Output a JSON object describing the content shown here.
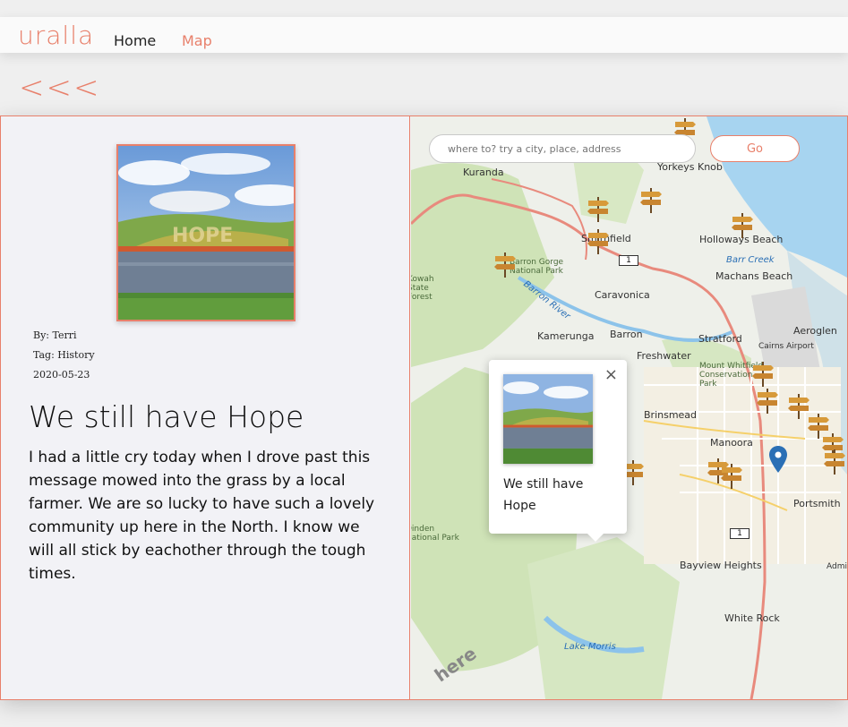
{
  "nav": {
    "logo": "uralla",
    "home": "Home",
    "map": "Map"
  },
  "back_label": "<<<",
  "story": {
    "author": "By: Terri",
    "tag": "Tag: History",
    "date": "2020-05-23",
    "title": "We still have Hope",
    "body": "I had a little cry today when I drove past this message mowed into the grass by a local farmer. We are so lucky to have such a lovely community up here in the North. I know we will all stick by eachother through the tough times."
  },
  "map": {
    "search_placeholder": "where to? try a city, place, address",
    "go_label": "Go",
    "popup_title": "We still have Hope",
    "popup_close": "×",
    "attribution": "here",
    "route_shield": "1",
    "places": [
      {
        "name": "Kuranda"
      },
      {
        "name": "Yorkeys Knob"
      },
      {
        "name": "Holloways Beach"
      },
      {
        "name": "Smithfield"
      },
      {
        "name": "Barr Creek"
      },
      {
        "name": "Machans Beach"
      },
      {
        "name": "Barron Gorge National Park"
      },
      {
        "name": "Caravonica"
      },
      {
        "name": "Kamerunga"
      },
      {
        "name": "Barron"
      },
      {
        "name": "Stratford"
      },
      {
        "name": "Aeroglen"
      },
      {
        "name": "Cairns Airport"
      },
      {
        "name": "Freshwater"
      },
      {
        "name": "Mount Whitfield Conservation Park"
      },
      {
        "name": "Brinsmead"
      },
      {
        "name": "Manoora"
      },
      {
        "name": "Portsmith"
      },
      {
        "name": "Bayview Heights"
      },
      {
        "name": "White Rock"
      },
      {
        "name": "Lake Morris"
      },
      {
        "name": "Barron River"
      },
      {
        "name": "Admiralty Island"
      },
      {
        "name": "Dinden National Park"
      },
      {
        "name": "Kowah State Forest"
      }
    ]
  },
  "colors": {
    "accent": "#e8806b",
    "map_water": "#a7d4f0",
    "map_park": "#cfe3b7",
    "pin": "#2a6fb5"
  }
}
